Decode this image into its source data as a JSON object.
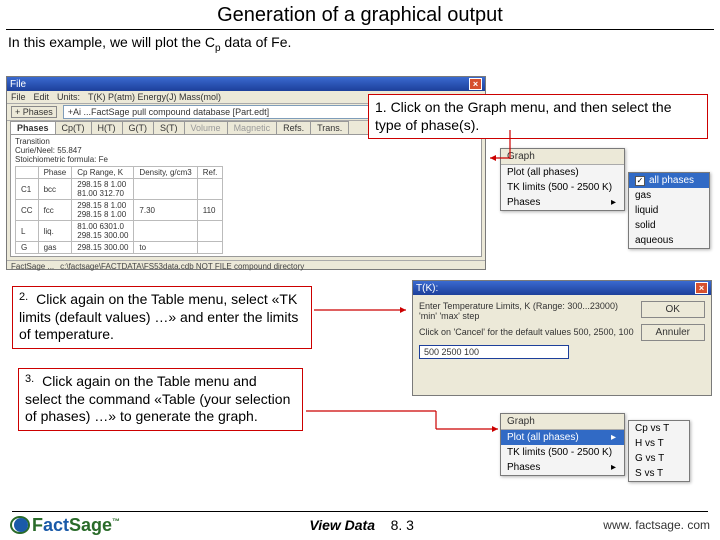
{
  "title": "Generation of a graphical output",
  "intro_prefix": "In this example, we will plot the C",
  "intro_sub": "p",
  "intro_suffix": " data of Fe.",
  "callout1": "1. Click on the Graph menu, and then select the type of phase(s).",
  "callout2_num": "2.",
  "callout2_text": "Click again on the Table menu, select «TK limits (default values) …» and enter the limits of temperature.",
  "callout3_num": "3.",
  "callout3_text": "Click again on the Table menu and select the command «Table (your selection of phases) …» to generate the graph.",
  "win1": {
    "title": "File",
    "unitsLabel": "Units:",
    "units": "T(K) P(atm) Energy(J) Mass(mol)",
    "tabs": [
      "Phases",
      "Cp(T)",
      "H(T)",
      "G(T)",
      "S(T)",
      "Volume",
      "Magnetic",
      "Refs.",
      "Trans."
    ],
    "path": "+Ai ...FactSage pull compound database [Part.edt]",
    "tran": "Transition",
    "curie": "Curie/Neel: 55.847",
    "stoich": "Stoichiometric formula: Fe",
    "th": {
      "phase": "Phase",
      "cp": "Cp Range, K",
      "dens": "Density, g/cm3",
      "ref": "Ref."
    },
    "rows": [
      {
        "code": "C1",
        "phase": "bcc",
        "cp1": "298.15  8  1.00",
        "cp2": "81.00  312.70",
        "dens": "",
        "ref": ""
      },
      {
        "code": "CC",
        "phase": "fcc",
        "cp1": "298.15  8  1.00",
        "cp2": "298.15  8  1.00",
        "dens": "7.30",
        "ref": "110"
      },
      {
        "code": "L",
        "phase": "liq.",
        "cp1": "81.00  6301.0",
        "cp2": "298.15  300.00",
        "dens": "",
        "ref": ""
      },
      {
        "code": "G",
        "phase": "gas",
        "cp1": "298.15  300.00",
        "cp2": "",
        "dens": "to",
        "ref": ""
      }
    ],
    "status1": "FactSage ...",
    "status2": "c:\\factsage\\FACTDATA\\FS53data.cdb  NOT FILE compound directory"
  },
  "dd1": {
    "hdr": "Graph",
    "items": [
      "Plot (all phases)",
      "TK limits (500 - 2500 K)",
      "Phases"
    ],
    "sub": [
      "all phases",
      "gas",
      "liquid",
      "solid",
      "aqueous"
    ]
  },
  "dlg": {
    "title": "T(K):",
    "line1": "Enter Temperature Limits, K (Range: 300...23000)",
    "line2": "'min' 'max' step",
    "line3": "Click on 'Cancel' for the default values 500, 2500, 100",
    "input": "500 2500 100",
    "ok": "OK",
    "cancel": "Annuler"
  },
  "dd2": {
    "hdr": "Graph",
    "items": [
      "Plot (all phases)",
      "TK limits (500 - 2500 K)",
      "Phases"
    ],
    "sub": [
      "Cp vs T",
      "H vs T",
      "G vs T",
      "S vs T"
    ]
  },
  "footer": {
    "viewdata": "View Data",
    "ver": "8. 3",
    "url": "www. factsage. com"
  }
}
